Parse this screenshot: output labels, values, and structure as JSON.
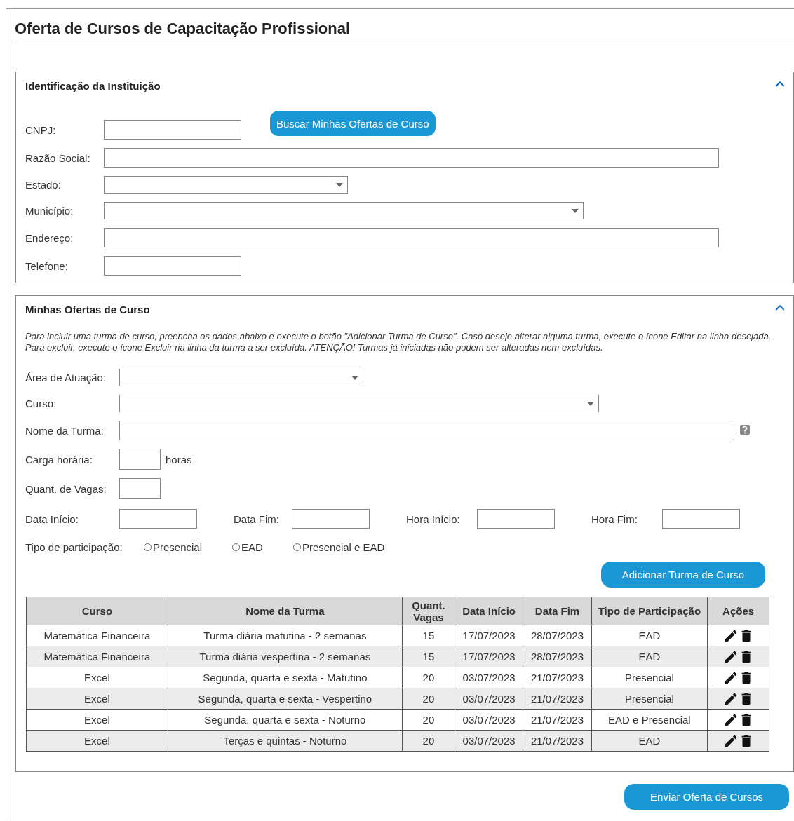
{
  "title": "Oferta de Cursos de Capacitação Profissional",
  "institution": {
    "title": "Identificação da Instituição",
    "expanded": true,
    "search_button": "Buscar Minhas Ofertas de Curso",
    "fields": [
      {
        "label": "CNPJ:",
        "kind": "text"
      },
      {
        "label": "Razão Social:",
        "kind": "text"
      },
      {
        "label": "Estado:",
        "kind": "select"
      },
      {
        "label": "Município:",
        "kind": "select"
      },
      {
        "label": "Endereço:",
        "kind": "text"
      },
      {
        "label": "Telefone:",
        "kind": "text"
      }
    ]
  },
  "offers": {
    "title": "Minhas Ofertas de Curso",
    "expanded": true,
    "instructions": "Para incluir uma turma de curso, preencha os dados abaixo e execute o botão \"Adicionar Turma de Curso\". Caso deseje alterar alguma turma, execute o ícone Editar na linha desejada. Para excluir, execute o ícone Excluir na linha da turma a ser excluída. ATENÇÃO! Turmas já iniciadas não podem ser alteradas nem excluídas.",
    "fields": [
      {
        "label": "Área de Atuação:",
        "kind": "select"
      },
      {
        "label": "Curso:",
        "kind": "select"
      },
      {
        "label": "Nome da Turma:",
        "kind": "text",
        "help": true
      },
      {
        "label": "Carga horária:",
        "kind": "text",
        "suffix": "horas"
      },
      {
        "label": "Quant. de Vagas:",
        "kind": "text"
      }
    ],
    "schedule_fields": [
      {
        "label": "Data Início:"
      },
      {
        "label": "Data Fim:"
      },
      {
        "label": "Hora Início:"
      },
      {
        "label": "Hora Fim:"
      }
    ],
    "participation": {
      "label": "Tipo de participação:",
      "options": [
        {
          "label": "Presencial",
          "selected": false
        },
        {
          "label": "EAD",
          "selected": false
        },
        {
          "label": "Presencial e EAD",
          "selected": false
        }
      ]
    },
    "add_button": "Adicionar Turma de Curso",
    "table": {
      "columns": [
        "Curso",
        "Nome da Turma",
        "Quant. Vagas",
        "Data Início",
        "Data Fim",
        "Tipo de Participação",
        "Ações"
      ],
      "rows": [
        {
          "cells": [
            "Matemática Financeira",
            "Turma diária matutina - 2 semanas",
            "15",
            "17/07/2023",
            "28/07/2023",
            "EAD"
          ]
        },
        {
          "cells": [
            "Matemática Financeira",
            "Turma diária vespertina - 2 semanas",
            "15",
            "17/07/2023",
            "28/07/2023",
            "EAD"
          ]
        },
        {
          "cells": [
            "Excel",
            "Segunda, quarta e sexta - Matutino",
            "20",
            "03/07/2023",
            "21/07/2023",
            "Presencial"
          ]
        },
        {
          "cells": [
            "Excel",
            "Segunda, quarta e sexta - Vespertino",
            "20",
            "03/07/2023",
            "21/07/2023",
            "Presencial"
          ]
        },
        {
          "cells": [
            "Excel",
            "Segunda, quarta e sexta - Noturno",
            "20",
            "03/07/2023",
            "21/07/2023",
            "EAD e Presencial"
          ]
        },
        {
          "cells": [
            "Excel",
            "Terças e quintas - Noturno",
            "20",
            "03/07/2023",
            "21/07/2023",
            "EAD"
          ]
        }
      ]
    }
  },
  "submit_button": "Enviar Oferta de Cursos"
}
